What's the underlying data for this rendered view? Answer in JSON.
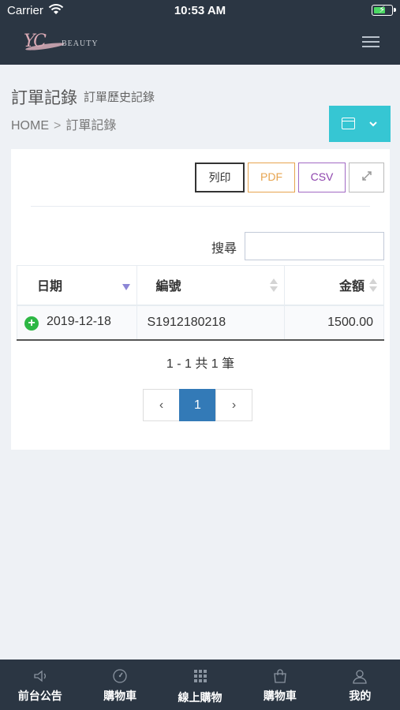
{
  "status_bar": {
    "carrier": "Carrier",
    "time": "10:53 AM"
  },
  "header": {
    "logo_script": "YC",
    "logo_brand": "BEAUTY",
    "menu_icon": "hamburger-icon"
  },
  "page": {
    "title": "訂單記錄",
    "subtitle": "訂單歷史記錄",
    "breadcrumb": {
      "home": "HOME",
      "separator": ">",
      "current": "訂單記錄"
    },
    "date_button": {
      "icon": "calendar-icon",
      "chevron": "chevron-down-icon"
    }
  },
  "toolbar": {
    "print_label": "列印",
    "pdf_label": "PDF",
    "csv_label": "CSV",
    "expand_icon": "expand-icon"
  },
  "search": {
    "label": "搜尋",
    "value": ""
  },
  "table": {
    "columns": [
      "日期",
      "編號",
      "金額"
    ],
    "rows": [
      {
        "date": "2019-12-18",
        "number": "S1912180218",
        "amount": "1500.00"
      }
    ]
  },
  "pagination": {
    "info": "1 - 1 共 1 筆",
    "prev": "‹",
    "current_page": "1",
    "next": "›"
  },
  "tab_bar": {
    "items": [
      {
        "label": "前台公告",
        "icon": "speaker-icon"
      },
      {
        "label": "購物車",
        "icon": "gauge-icon"
      },
      {
        "label": "線上購物",
        "icon": "grid-icon"
      },
      {
        "label": "購物車",
        "icon": "shopping-bag-icon"
      },
      {
        "label": "我的",
        "icon": "user-icon"
      }
    ]
  },
  "colors": {
    "dark_bar": "#2b3643",
    "accent_cyan": "#36c6d3",
    "pdf_orange": "#e7a44f",
    "csv_purple": "#8e44ad",
    "active_page": "#337ab7",
    "expand_green": "#2db744"
  }
}
